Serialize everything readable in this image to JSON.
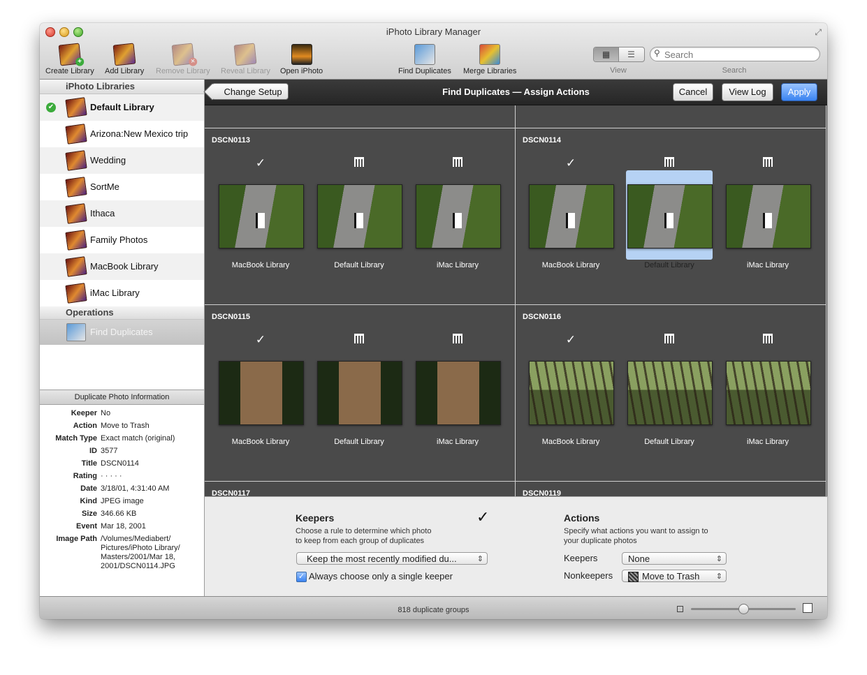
{
  "window": {
    "title": "iPhoto Library Manager"
  },
  "toolbar": {
    "create_library": "Create Library",
    "add_library": "Add Library",
    "remove_library": "Remove Library",
    "reveal_library": "Reveal Library",
    "open_iphoto": "Open iPhoto",
    "find_duplicates": "Find Duplicates",
    "merge_libraries": "Merge Libraries",
    "view_label": "View",
    "search_placeholder": "Search",
    "search_label": "Search"
  },
  "sidebar": {
    "libraries_header": "iPhoto Libraries",
    "libraries": [
      {
        "label": "Default Library"
      },
      {
        "label": "Arizona:New Mexico trip"
      },
      {
        "label": "Wedding"
      },
      {
        "label": "SortMe"
      },
      {
        "label": "Ithaca"
      },
      {
        "label": "Family Photos"
      },
      {
        "label": "MacBook Library"
      },
      {
        "label": "iMac Library"
      }
    ],
    "operations_header": "Operations",
    "operations": [
      {
        "label": "Find Duplicates"
      }
    ]
  },
  "info": {
    "header": "Duplicate Photo Information",
    "rows": [
      {
        "key": "Keeper",
        "value": "No"
      },
      {
        "key": "Action",
        "value": "Move to Trash"
      },
      {
        "key": "Match Type",
        "value": "Exact match (original)"
      },
      {
        "key": "ID",
        "value": "3577"
      },
      {
        "key": "Title",
        "value": "DSCN0114"
      },
      {
        "key": "Rating",
        "value": "· · · · ·"
      },
      {
        "key": "Date",
        "value": "3/18/01, 4:31:40 AM"
      },
      {
        "key": "Kind",
        "value": "JPEG image"
      },
      {
        "key": "Size",
        "value": "346.66 KB"
      },
      {
        "key": "Event",
        "value": "Mar 18, 2001"
      },
      {
        "key": "Image Path",
        "value": "/Volumes/Mediabert/ Pictures/iPhoto Library/ Masters/2001/Mar 18, 2001/DSCN0114.JPG"
      }
    ]
  },
  "subbar": {
    "back": "Change Setup",
    "title": "Find Duplicates — Assign Actions",
    "cancel": "Cancel",
    "view_log": "View Log",
    "apply": "Apply"
  },
  "groups": [
    {
      "name": "DSCN0113",
      "photos": [
        "MacBook Library",
        "Default Library",
        "iMac Library"
      ]
    },
    {
      "name": "DSCN0114",
      "photos": [
        "MacBook Library",
        "Default Library",
        "iMac Library"
      ]
    },
    {
      "name": "DSCN0115",
      "photos": [
        "MacBook Library",
        "Default Library",
        "iMac Library"
      ]
    },
    {
      "name": "DSCN0116",
      "photos": [
        "MacBook Library",
        "Default Library",
        "iMac Library"
      ]
    },
    {
      "name": "DSCN0117"
    },
    {
      "name": "DSCN0119"
    }
  ],
  "keepers": {
    "title": "Keepers",
    "desc1": "Choose a rule to determine which photo",
    "desc2": "to keep from each group of duplicates",
    "rule": "Keep the most recently modified du...",
    "single_keeper": "Always choose only a single keeper"
  },
  "actions": {
    "title": "Actions",
    "desc1": "Specify what actions you want to assign to",
    "desc2": "your duplicate photos",
    "keepers_label": "Keepers",
    "keepers_value": "None",
    "nonkeepers_label": "Nonkeepers",
    "nonkeepers_value": "Move to Trash"
  },
  "status": {
    "count": "818 duplicate groups",
    "zoom_fraction": 0.5
  }
}
